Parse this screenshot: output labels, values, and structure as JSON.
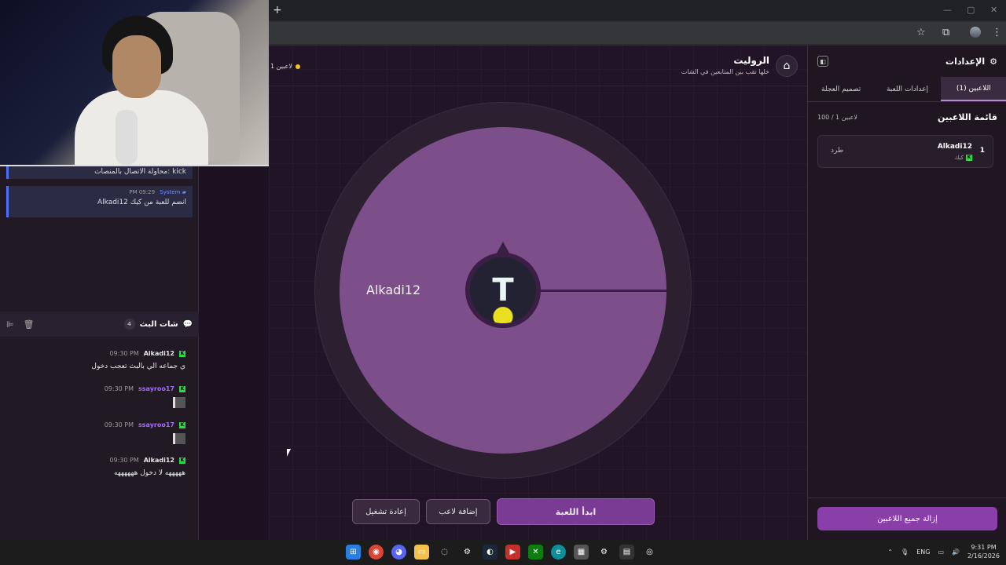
{
  "browser": {
    "new_tab": "+",
    "controls": {
      "min": "—",
      "max": "▢",
      "close": "✕"
    }
  },
  "left_panel": {
    "system_messages": [
      {
        "time": "",
        "sender": "",
        "text": "محاولة الاتصال بالمنصات: kick"
      },
      {
        "time": "PM 09:29",
        "sender": "System",
        "text": "Alkadi12 انضم للعبة من كيك"
      }
    ],
    "chat": {
      "title": "شات البث",
      "count": "4",
      "messages": [
        {
          "user": "Alkadi12",
          "time": "09:30 PM",
          "text": "ي جماعه الي بالبث تعجب دخول"
        },
        {
          "user": "ssayroo17",
          "time": "09:30 PM",
          "text": ""
        },
        {
          "user": "ssayroo17",
          "time": "09:30 PM",
          "text": ""
        },
        {
          "user": "Alkadi12",
          "time": "09:30 PM",
          "text": "هههههه لا دخول ههههههه"
        }
      ]
    }
  },
  "game": {
    "title": "الروليت",
    "subtitle": "خلها تقب بين المتابعين في الشات",
    "player_count": "1 لاعبين",
    "wheel_label": "Alkadi12",
    "hub_logo": "T",
    "buttons": {
      "start": "ابدأ اللعبة",
      "add_player": "إضافة لاعب",
      "restart": "إعادة تشغيل"
    }
  },
  "settings": {
    "title": "الإعدادات",
    "tabs": [
      "اللاعبين (1)",
      "إعدادات اللعبة",
      "تصميم العجلة"
    ],
    "players_title": "قائمة اللاعبين",
    "players_count": "100 / 1 لاعبين",
    "players": [
      {
        "num": "1",
        "name": "Alkadi12",
        "platform": "كيك",
        "kick_label": "طرد"
      }
    ],
    "remove_all": "إزالة جميع اللاعبين"
  },
  "taskbar": {
    "lang": "ENG",
    "time": "9:31 PM",
    "date": "2/16/2026"
  },
  "colors": {
    "accent": "#8a3fa8",
    "wheel": "#7d4f8a",
    "kick_green": "#2bdb45"
  }
}
